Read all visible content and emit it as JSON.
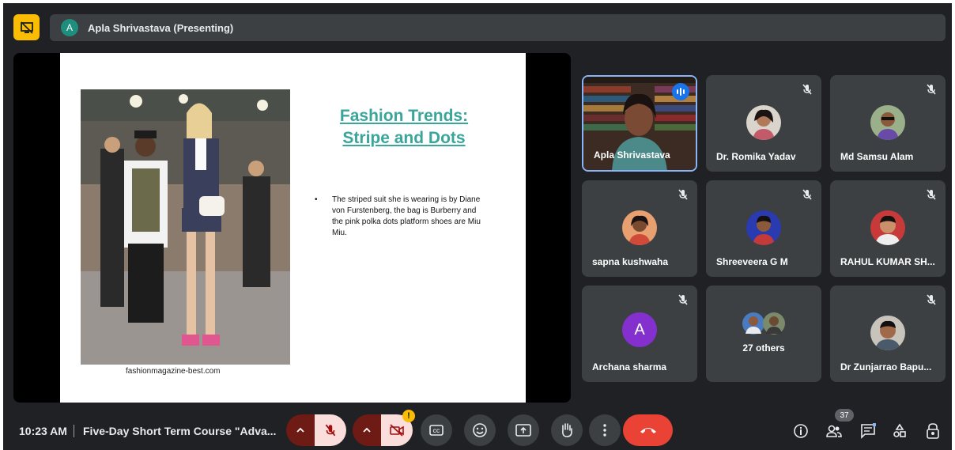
{
  "top_bar": {
    "presenter_initial": "A",
    "presenter_title": "Apla Shrivastava (Presenting)"
  },
  "slide": {
    "title_line1": "Fashion Trends:",
    "title_line2": "Stripe and Dots",
    "bullet": "The striped suit she is wearing is by Diane von Furstenberg, the bag is Burberry and the pink polka dots platform shoes are Miu Miu.",
    "photo_caption": "fashionmagazine-best.com"
  },
  "participants": [
    {
      "name": "Apla Shrivastava",
      "mic": "speaking"
    },
    {
      "name": "Dr. Romika Yadav",
      "mic": "muted"
    },
    {
      "name": "Md Samsu Alam",
      "mic": "muted"
    },
    {
      "name": "sapna kushwaha",
      "mic": "muted"
    },
    {
      "name": "Shreeveera G M",
      "mic": "muted"
    },
    {
      "name": "RAHUL KUMAR SH...",
      "mic": "muted"
    },
    {
      "name": "Archana sharma",
      "mic": "muted",
      "initial": "A"
    },
    {
      "name": "27 others",
      "mic": "none"
    },
    {
      "name": "Dr Zunjarrao Bapu...",
      "mic": "muted"
    }
  ],
  "bottom_bar": {
    "time": "10:23 AM",
    "meeting_title": "Five-Day Short Term Course \"Adva...",
    "people_count": "37",
    "camera_warning": "!"
  },
  "colors": {
    "background": "#202124",
    "tile": "#3c4043",
    "end_call": "#ea4335",
    "present_chip": "#fbbc04",
    "slide_title": "#3aa59a"
  }
}
